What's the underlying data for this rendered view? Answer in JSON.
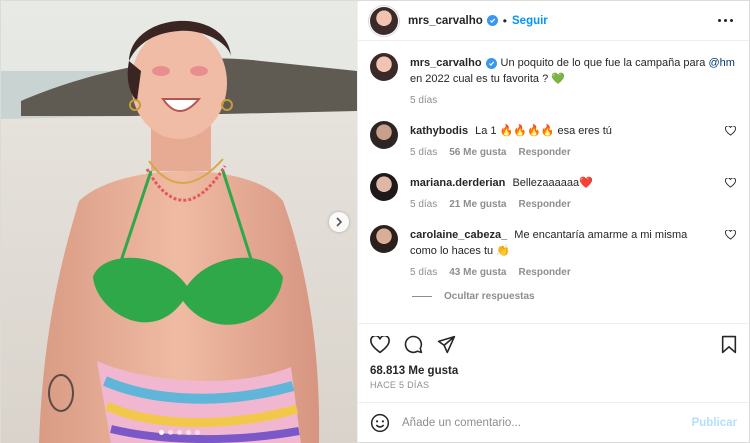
{
  "header": {
    "username": "mrs_carvalho",
    "separator": "•",
    "follow_label": "Seguir"
  },
  "caption": {
    "username": "mrs_carvalho",
    "text": "Un poquito de lo que fue la campaña para ",
    "mention": "@hm",
    "text_end": " en 2022 cual es tu favorita ? 💚",
    "time": "5 días"
  },
  "comments": [
    {
      "username": "kathybodis",
      "text": "La 1 🔥🔥🔥🔥 esa eres tú",
      "time": "5 días",
      "likes": "56 Me gusta",
      "reply": "Responder"
    },
    {
      "username": "mariana.derderian",
      "text": "Bellezaaaaaa❤️",
      "time": "5 días",
      "likes": "21 Me gusta",
      "reply": "Responder"
    },
    {
      "username": "carolaine_cabeza_",
      "text": "Me encantaría amarme a mi misma como lo haces tu 👏",
      "time": "5 días",
      "likes": "43 Me gusta",
      "reply": "Responder"
    }
  ],
  "hide_replies_label": "Ocultar respuestas",
  "likes_label": "68.813 Me gusta",
  "posted_ago": "HACE 5 DÍAS",
  "comment_input": {
    "placeholder": "Añade un comentario...",
    "value": ""
  },
  "publish_label": "Publicar",
  "carousel": {
    "slides": 5,
    "active_index": 0
  },
  "icons": [
    "verified-icon",
    "more-options-icon",
    "heart-icon",
    "comment-icon",
    "share-icon",
    "bookmark-icon",
    "emoji-icon",
    "chevron-right-icon"
  ],
  "colors": {
    "accent": "#0095f6",
    "verified": "#3897f0",
    "publish_disabled": "#b2dffc",
    "bikini": "#2fa84a"
  }
}
